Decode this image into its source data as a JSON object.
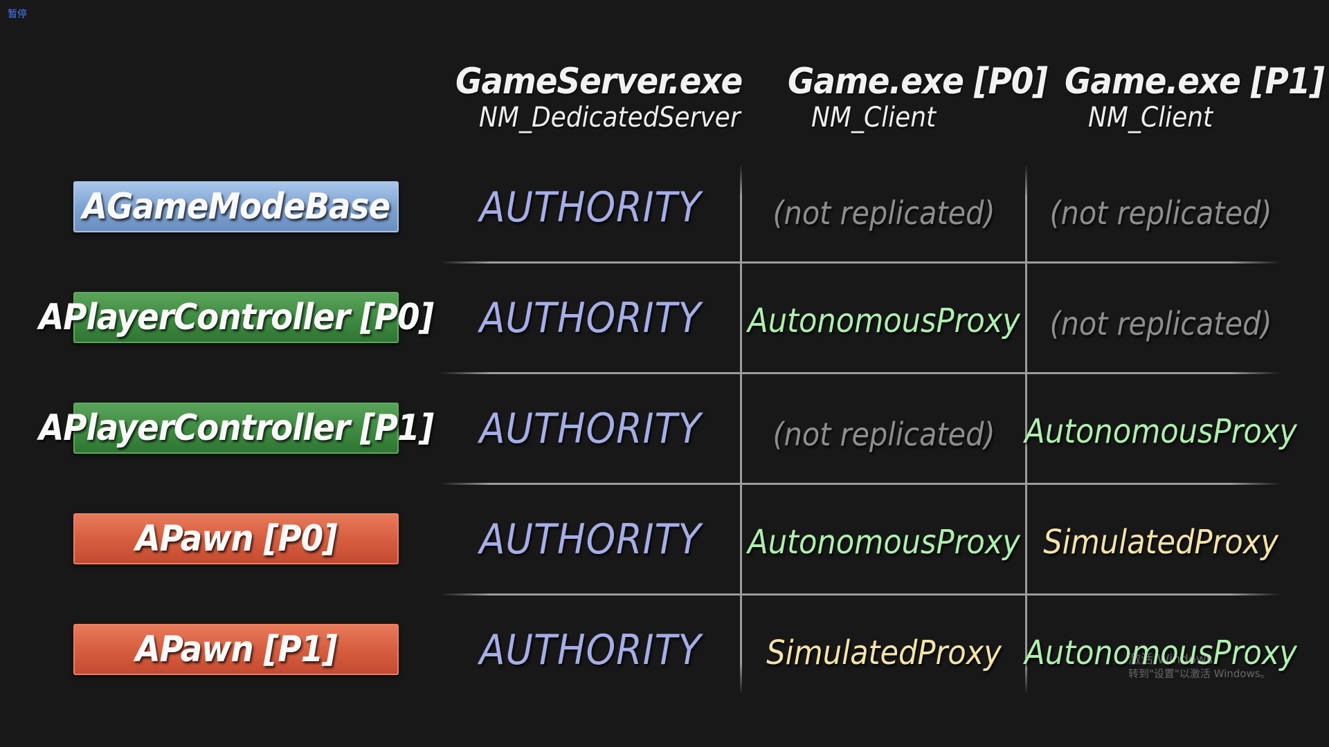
{
  "overlay": {
    "paused_label": "暂停"
  },
  "columns": [
    {
      "exe": "GameServer.exe",
      "mode": "NM_DedicatedServer"
    },
    {
      "exe": "Game.exe [P0]",
      "mode": "NM_Client"
    },
    {
      "exe": "Game.exe [P1]",
      "mode": "NM_Client"
    }
  ],
  "rows": [
    {
      "label": "AGameModeBase",
      "color": "blue",
      "cells": [
        "AUTHORITY",
        "(not replicated)",
        "(not replicated)"
      ]
    },
    {
      "label": "APlayerController [P0]",
      "color": "green",
      "cells": [
        "AUTHORITY",
        "AutonomousProxy",
        "(not replicated)"
      ]
    },
    {
      "label": "APlayerController [P1]",
      "color": "green",
      "cells": [
        "AUTHORITY",
        "(not replicated)",
        "AutonomousProxy"
      ]
    },
    {
      "label": "APawn [P0]",
      "color": "red",
      "cells": [
        "AUTHORITY",
        "AutonomousProxy",
        "SimulatedProxy"
      ]
    },
    {
      "label": "APawn [P1]",
      "color": "red",
      "cells": [
        "AUTHORITY",
        "SimulatedProxy",
        "AutonomousProxy"
      ]
    }
  ],
  "colors": {
    "background": "#181818",
    "authority": "#a6aee8",
    "not_replicated": "#8e8e8e",
    "autonomous_proxy": "#aef0ae",
    "simulated_proxy": "#f6e3a8",
    "label_blue": "#7ca0d0",
    "label_green": "#3e8a41",
    "label_red": "#d65c3e"
  },
  "watermark": {
    "line1": "激活 Windows",
    "line2": "转到\"设置\"以激活 Windows。"
  }
}
